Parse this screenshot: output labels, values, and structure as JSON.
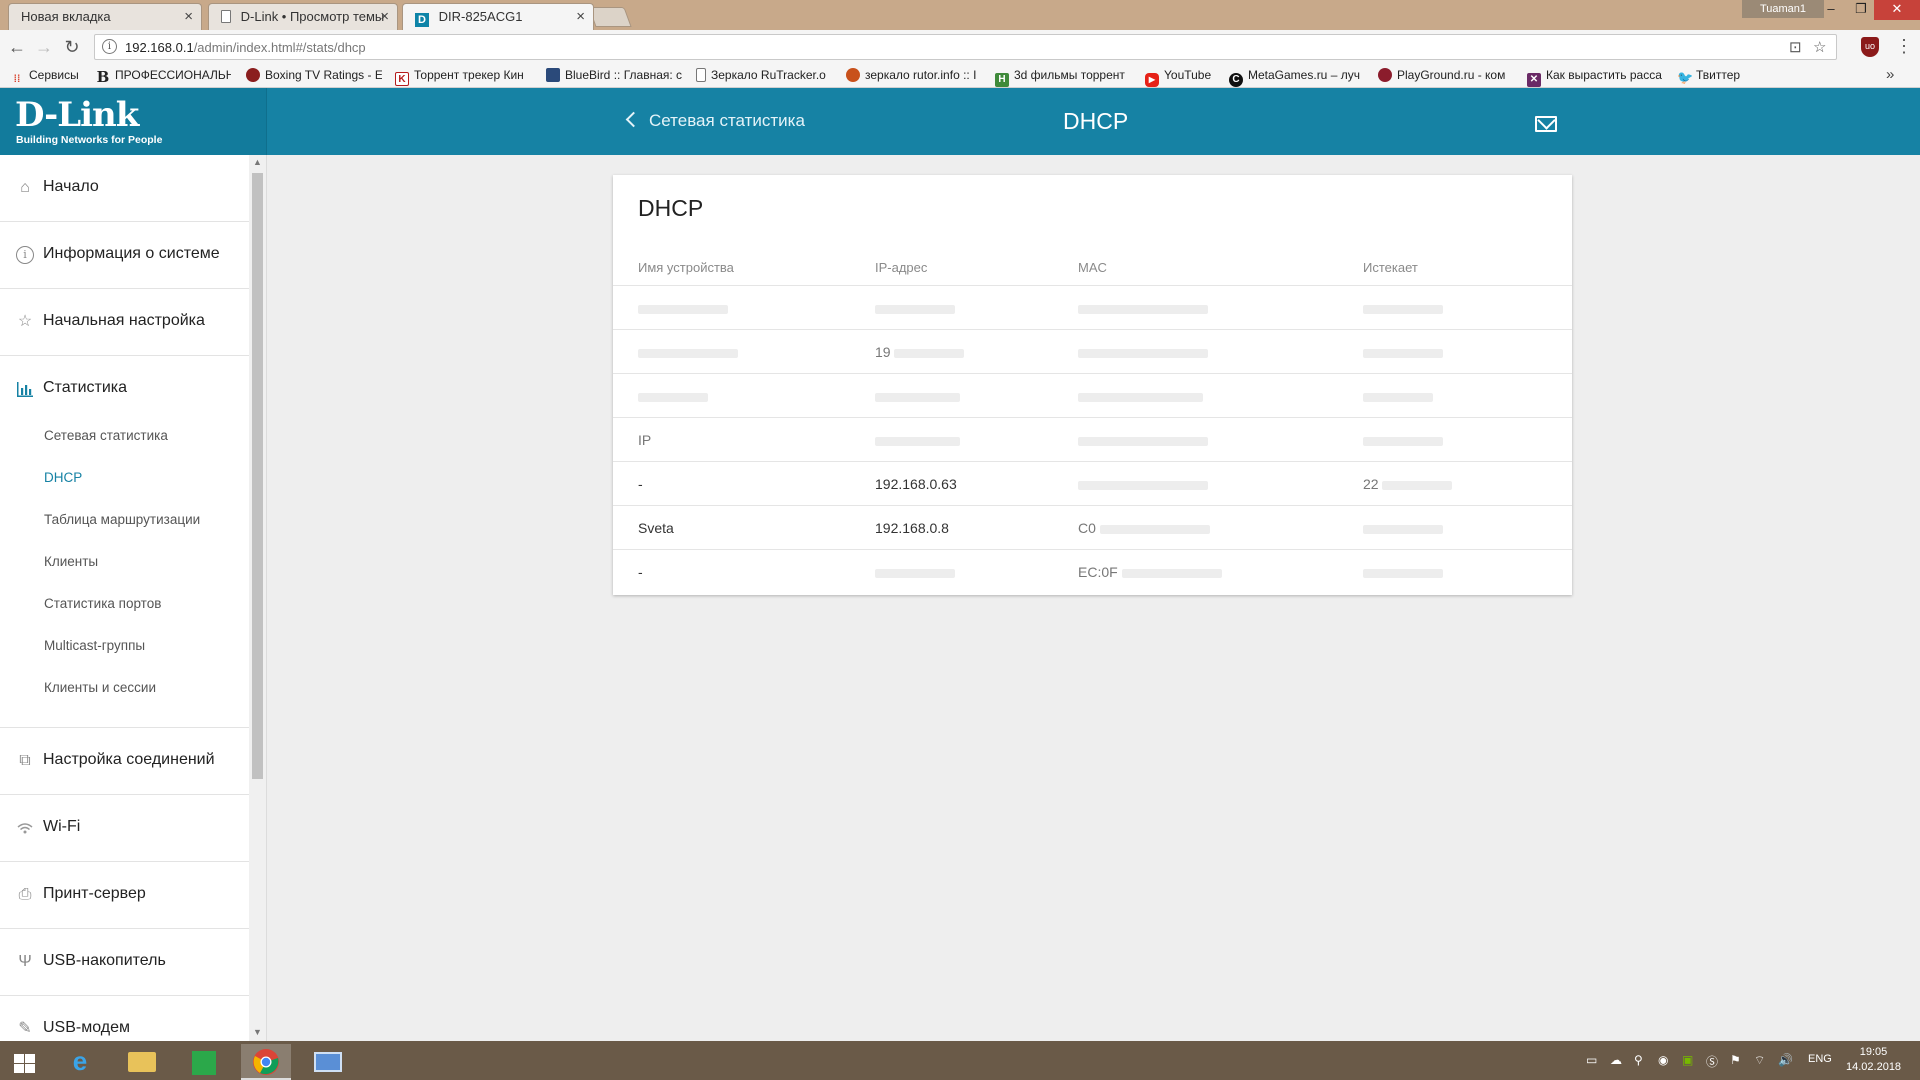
{
  "browser": {
    "tabs": [
      {
        "title": "Новая вкладка",
        "active": false
      },
      {
        "title": "D-Link • Просмотр темы",
        "active": false
      },
      {
        "title": "DIR-825ACG1",
        "active": true
      }
    ],
    "user": "Tuaman1",
    "url_host": "192.168.0.1",
    "url_path": "/admin/index.html#/stats/dhcp",
    "bookmarks": [
      {
        "label": "Сервисы",
        "icon": "apps-grid-icon",
        "color": "#d9442f"
      },
      {
        "label": "ПРОФЕССИОНАЛЬН",
        "icon": "b-letter-icon",
        "color": "#222222"
      },
      {
        "label": "Boxing TV Ratings - E",
        "icon": "boxing-site-icon",
        "color": "#8b1e1e"
      },
      {
        "label": "Торрент трекер Кин",
        "icon": "k-letter-icon",
        "color": "#b51c1c"
      },
      {
        "label": "BlueBird :: Главная: c",
        "icon": "bluebird-icon",
        "color": "#2b4a7a"
      },
      {
        "label": "Зеркало RuTracker.o",
        "icon": "doc-icon",
        "color": "#ffffff"
      },
      {
        "label": "зеркало rutor.info :: I",
        "icon": "rutor-icon",
        "color": "#c8511b"
      },
      {
        "label": "3d фильмы торрент",
        "icon": "3d-films-icon",
        "color": "#3f8a3a"
      },
      {
        "label": "YouTube",
        "icon": "youtube-icon",
        "color": "#e62117"
      },
      {
        "label": "MetaGames.ru – луч",
        "icon": "metagames-icon",
        "color": "#111111"
      },
      {
        "label": "PlayGround.ru - ком",
        "icon": "playground-icon",
        "color": "#8b1c2c"
      },
      {
        "label": "Как вырастить расса",
        "icon": "plant-icon",
        "color": "#6a2a66"
      },
      {
        "label": "Твиттер",
        "icon": "twitter-icon",
        "color": "#1da1f2"
      }
    ]
  },
  "header": {
    "logo": "D-Link",
    "logo_tagline": "Building Networks for People",
    "back_label": "Сетевая статистика",
    "title": "DHCP"
  },
  "sidebar": {
    "items": [
      {
        "label": "Начало",
        "icon": "home-icon"
      },
      {
        "label": "Информация о системе",
        "icon": "info-icon"
      },
      {
        "label": "Начальная настройка",
        "icon": "star-icon"
      },
      {
        "label": "Статистика",
        "icon": "bar-chart-icon",
        "active": true
      },
      {
        "label": "Настройка соединений",
        "icon": "connections-icon"
      },
      {
        "label": "Wi-Fi",
        "icon": "wifi-icon"
      },
      {
        "label": "Принт-сервер",
        "icon": "printer-icon"
      },
      {
        "label": "USB-накопитель",
        "icon": "usb-icon"
      },
      {
        "label": "USB-модем",
        "icon": "usb-modem-icon"
      }
    ],
    "sub_items": [
      {
        "label": "Сетевая статистика",
        "active": false
      },
      {
        "label": "DHCP",
        "active": true
      },
      {
        "label": "Таблица маршрутизации",
        "active": false
      },
      {
        "label": "Клиенты",
        "active": false
      },
      {
        "label": "Статистика портов",
        "active": false
      },
      {
        "label": "Multicast-группы",
        "active": false
      },
      {
        "label": "Клиенты и сессии",
        "active": false
      }
    ]
  },
  "card": {
    "title": "DHCP",
    "columns": [
      "Имя устройства",
      "IP-адрес",
      "MAC",
      "Истекает"
    ],
    "rows": [
      {
        "name": "",
        "ip": "",
        "mac": "",
        "expires": ""
      },
      {
        "name": "",
        "ip": "19",
        "mac": "",
        "expires": ""
      },
      {
        "name": "",
        "ip": "",
        "mac": "",
        "expires": ""
      },
      {
        "name": "IP",
        "ip": "",
        "mac": "",
        "expires": ""
      },
      {
        "name": "-",
        "ip": "192.168.0.63",
        "mac": "",
        "expires": "22"
      },
      {
        "name": "Sveta",
        "ip": "192.168.0.8",
        "mac": "C0",
        "expires": ""
      },
      {
        "name": "-",
        "ip": "",
        "mac": "EC:0F",
        "expires": ""
      }
    ]
  },
  "taskbar": {
    "language": "ENG",
    "time": "19:05",
    "date": "14.02.2018"
  },
  "colors": {
    "brand": "#1682a4",
    "active_link": "#1682a4",
    "page_bg": "#eeeeee"
  }
}
